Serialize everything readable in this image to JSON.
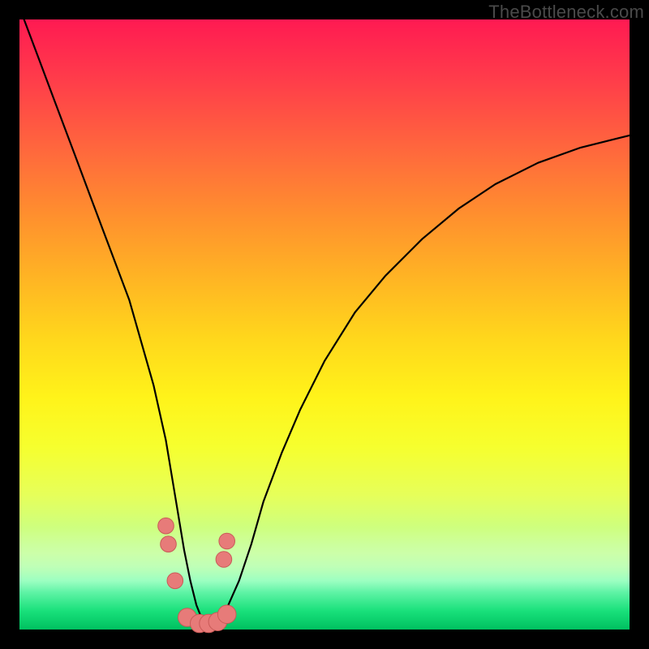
{
  "watermark": "TheBottleneck.com",
  "colors": {
    "frame": "#000000",
    "curve_stroke": "#000000",
    "marker_fill": "#e77b79",
    "marker_stroke": "#c95a57"
  },
  "chart_data": {
    "type": "line",
    "title": "",
    "xlabel": "",
    "ylabel": "",
    "xlim": [
      0,
      100
    ],
    "ylim": [
      0,
      100
    ],
    "grid": false,
    "legend": false,
    "series": [
      {
        "name": "curve",
        "x": [
          0,
          3,
          6,
          9,
          12,
          15,
          18,
          20,
          22,
          24,
          25,
          26,
          27,
          28,
          29,
          30,
          31,
          32,
          33,
          34,
          36,
          38,
          40,
          43,
          46,
          50,
          55,
          60,
          66,
          72,
          78,
          85,
          92,
          100
        ],
        "y": [
          102,
          94,
          86,
          78,
          70,
          62,
          54,
          47,
          40,
          31,
          25,
          19,
          13,
          8,
          4,
          1.5,
          0.7,
          0.7,
          1.5,
          3.5,
          8,
          14,
          21,
          29,
          36,
          44,
          52,
          58,
          64,
          69,
          73,
          76.5,
          79,
          81
        ]
      }
    ],
    "markers": [
      {
        "x": 24.0,
        "y": 17,
        "r": 1.3
      },
      {
        "x": 24.4,
        "y": 14,
        "r": 1.3
      },
      {
        "x": 25.5,
        "y": 8,
        "r": 1.3
      },
      {
        "x": 27.5,
        "y": 2,
        "r": 1.5
      },
      {
        "x": 29.5,
        "y": 1,
        "r": 1.5
      },
      {
        "x": 31.0,
        "y": 1,
        "r": 1.5
      },
      {
        "x": 32.5,
        "y": 1.3,
        "r": 1.5
      },
      {
        "x": 34.0,
        "y": 2.5,
        "r": 1.5
      },
      {
        "x": 33.5,
        "y": 11.5,
        "r": 1.3
      },
      {
        "x": 34.0,
        "y": 14.5,
        "r": 1.3
      }
    ]
  }
}
